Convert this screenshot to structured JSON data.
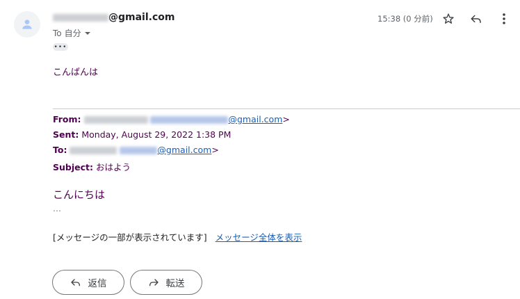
{
  "sender": {
    "email_domain": "@gmail.com"
  },
  "recipient": {
    "prefix": "To",
    "name": "自分"
  },
  "time": "15:38 (0 分前)",
  "greeting": "こんばんは",
  "quoted": {
    "from_label": "From:",
    "from_email": "@gmail.com",
    "sent_label": "Sent:",
    "sent_value": "Monday, August 29, 2022 1:38 PM",
    "to_label": "To:",
    "to_email": "@gmail.com",
    "subject_label": "Subject:",
    "subject_value": "おはよう",
    "angle": ">"
  },
  "body": "こんにちは",
  "ellipsis": "…",
  "truncated_notice": "[メッセージの一部が表示されています]",
  "view_full_link": "メッセージ全体を表示",
  "buttons": {
    "reply": "返信",
    "forward": "転送"
  },
  "icons": [
    "person-icon",
    "star-icon",
    "reply-icon",
    "more-vert-icon",
    "chevron-down-icon",
    "forward-icon"
  ]
}
